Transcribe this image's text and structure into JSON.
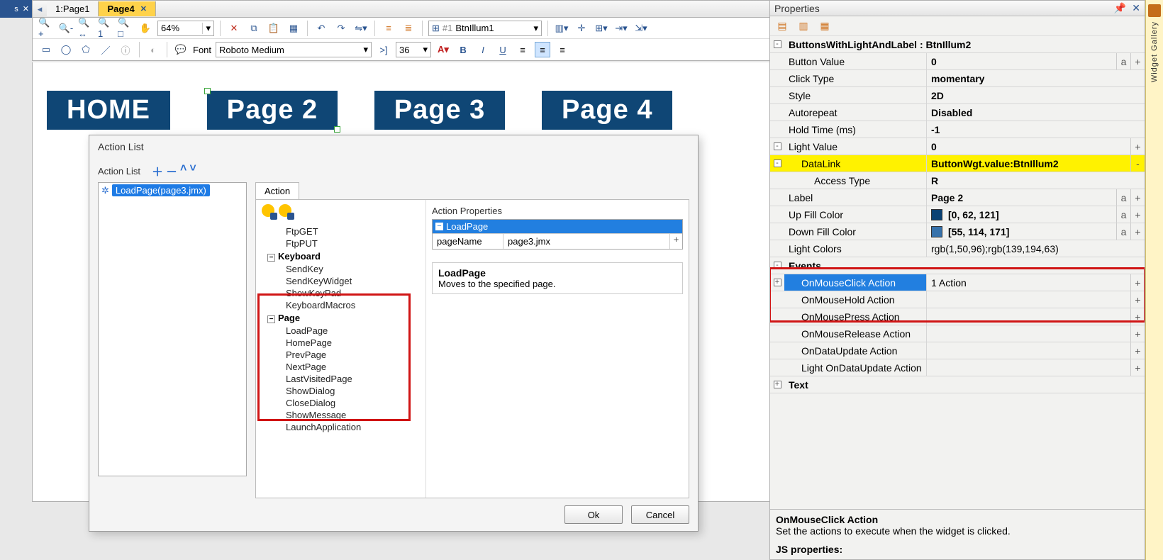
{
  "tabs": {
    "tab1": "1:Page1",
    "tab2": "Page4"
  },
  "toolbar": {
    "zoom": "64%",
    "widget_name_prefix": "#1",
    "widget_name": "BtnIllum1",
    "font_label": "Font",
    "font_name": "Roboto Medium",
    "font_size": "36"
  },
  "pages": {
    "home": "HOME",
    "p2": "Page 2",
    "p3": "Page 3",
    "p4": "Page 4"
  },
  "dialog": {
    "title": "Action List",
    "list_label": "Action List",
    "list_item": "LoadPage(page3.jmx)",
    "tab_action": "Action",
    "action_props_label": "Action Properties",
    "loadpage_hdr": "LoadPage",
    "prop_pageName": "pageName",
    "prop_pageName_val": "page3.jmx",
    "desc_title": "LoadPage",
    "desc_text": "Moves to the specified page.",
    "ok": "Ok",
    "cancel": "Cancel",
    "tree": {
      "ftpget": "FtpGET",
      "ftpput": "FtpPUT",
      "keyboard": "Keyboard",
      "sendkey": "SendKey",
      "sendkeywidget": "SendKeyWidget",
      "showkeypad": "ShowKeyPad",
      "kbmacros": "KeyboardMacros",
      "page": "Page",
      "loadpage": "LoadPage",
      "homepage": "HomePage",
      "prevpage": "PrevPage",
      "nextpage": "NextPage",
      "lastvisited": "LastVisitedPage",
      "showdialog": "ShowDialog",
      "closedialog": "CloseDialog",
      "showmessage": "ShowMessage",
      "launchapp": "LaunchApplication"
    }
  },
  "props": {
    "title": "Properties",
    "header": "ButtonsWithLightAndLabel : BtnIllum2",
    "button_value_l": "Button Value",
    "button_value_v": "0",
    "click_type_l": "Click Type",
    "click_type_v": "momentary",
    "style_l": "Style",
    "style_v": "2D",
    "autorepeat_l": "Autorepeat",
    "autorepeat_v": "Disabled",
    "holdtime_l": "Hold Time (ms)",
    "holdtime_v": "-1",
    "lightvalue_l": "Light Value",
    "lightvalue_v": "0",
    "datalink_l": "DataLink",
    "datalink_v": "ButtonWgt.value:BtnIllum2",
    "accesstype_l": "Access Type",
    "accesstype_v": "R",
    "label_l": "Label",
    "label_v": "Page 2",
    "upfill_l": "Up Fill Color",
    "upfill_v": "[0, 62, 121]",
    "upfill_c": "#0b4274",
    "downfill_l": "Down Fill Color",
    "downfill_v": "[55, 114, 171]",
    "downfill_c": "#3772ab",
    "lightcolors_l": "Light Colors",
    "lightcolors_v": "rgb(1,50,96);rgb(139,194,63)",
    "events_l": "Events",
    "onmouseclick_l": "OnMouseClick Action",
    "onmouseclick_v": "1 Action",
    "onmousehold_l": "OnMouseHold Action",
    "onmousepress_l": "OnMousePress Action",
    "onmouserelease_l": "OnMouseRelease Action",
    "ondataupdate_l": "OnDataUpdate Action",
    "lightondataupdate_l": "Light OnDataUpdate Action",
    "text_l": "Text",
    "desc_title": "OnMouseClick Action",
    "desc_text": "Set the actions to execute when the widget is clicked.",
    "jsprops": "JS properties:"
  },
  "gallery": "Widget Gallery"
}
